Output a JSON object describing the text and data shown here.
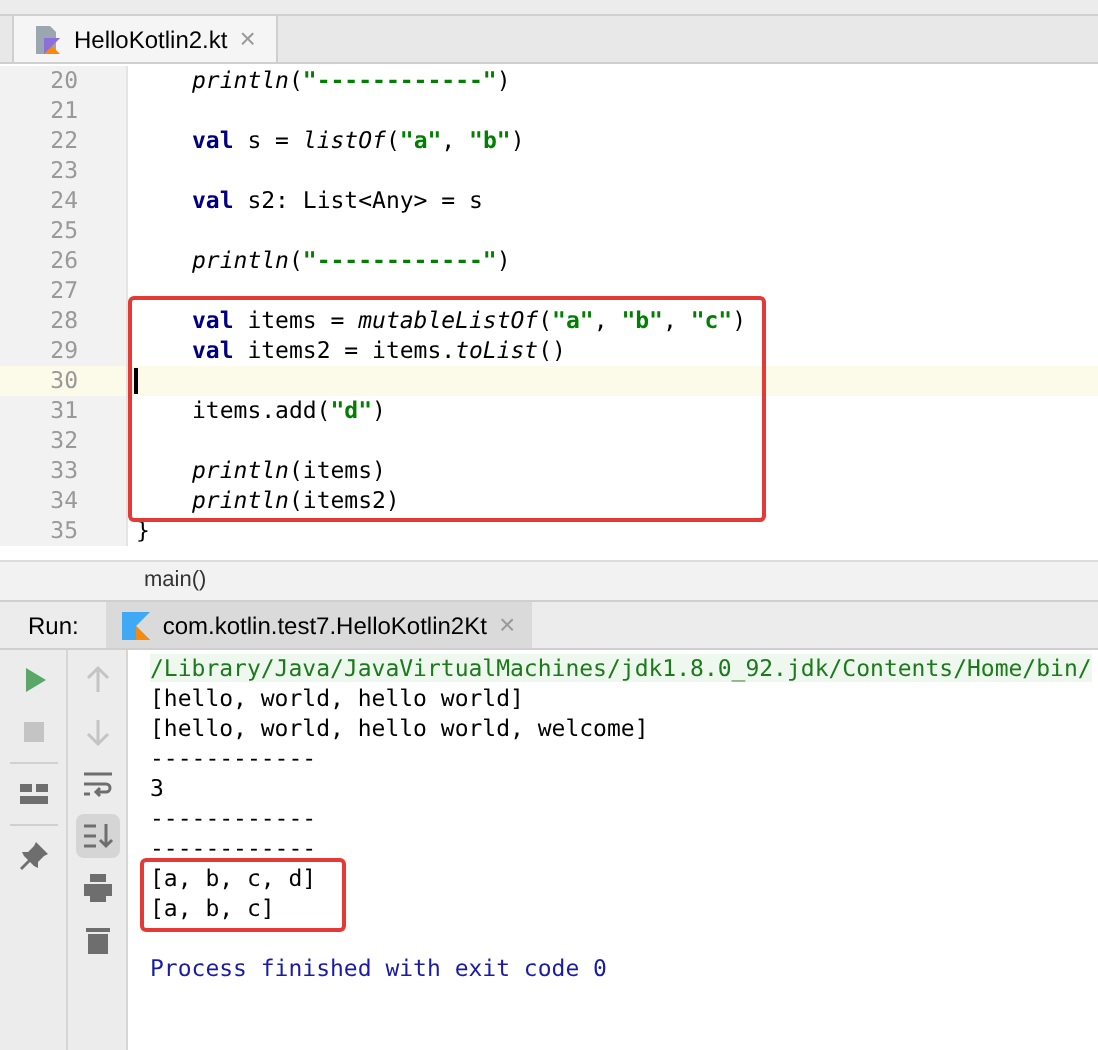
{
  "editor_tabs": [
    {
      "label": "HelloKotlin2.kt",
      "selected": true,
      "close": "×"
    }
  ],
  "code_lines": [
    {
      "number": "20",
      "current": false,
      "boxed": false,
      "indented": true,
      "tokens": [
        {
          "kind": "call",
          "text": "println"
        },
        {
          "kind": "plain",
          "text": "("
        },
        {
          "kind": "string",
          "text": "\"------------\""
        },
        {
          "kind": "plain",
          "text": ")"
        }
      ]
    },
    {
      "number": "21",
      "current": false,
      "boxed": false
    },
    {
      "number": "22",
      "current": false,
      "boxed": false,
      "indented": true,
      "tokens": [
        {
          "kind": "keyword",
          "text": "val"
        },
        {
          "kind": "plain",
          "text": " s = "
        },
        {
          "kind": "call",
          "text": "listOf"
        },
        {
          "kind": "plain",
          "text": "("
        },
        {
          "kind": "string",
          "text": "\"a\""
        },
        {
          "kind": "plain",
          "text": ", "
        },
        {
          "kind": "string",
          "text": "\"b\""
        },
        {
          "kind": "plain",
          "text": ")"
        }
      ]
    },
    {
      "number": "23",
      "current": false,
      "boxed": false
    },
    {
      "number": "24",
      "current": false,
      "boxed": false,
      "indented": true,
      "tokens": [
        {
          "kind": "keyword",
          "text": "val"
        },
        {
          "kind": "plain",
          "text": " s2: List<Any> = s"
        }
      ]
    },
    {
      "number": "25",
      "current": false,
      "boxed": false
    },
    {
      "number": "26",
      "current": false,
      "boxed": false,
      "indented": true,
      "tokens": [
        {
          "kind": "call",
          "text": "println"
        },
        {
          "kind": "plain",
          "text": "("
        },
        {
          "kind": "string",
          "text": "\"------------\""
        },
        {
          "kind": "plain",
          "text": ")"
        }
      ]
    },
    {
      "number": "27",
      "current": false,
      "boxed": false
    },
    {
      "number": "28",
      "current": false,
      "boxed": true,
      "indented": true,
      "tokens": [
        {
          "kind": "keyword",
          "text": "val"
        },
        {
          "kind": "plain",
          "text": " items = "
        },
        {
          "kind": "call",
          "text": "mutableListOf"
        },
        {
          "kind": "plain",
          "text": "("
        },
        {
          "kind": "string",
          "text": "\"a\""
        },
        {
          "kind": "plain",
          "text": ", "
        },
        {
          "kind": "string",
          "text": "\"b\""
        },
        {
          "kind": "plain",
          "text": ", "
        },
        {
          "kind": "string",
          "text": "\"c\""
        },
        {
          "kind": "plain",
          "text": ")"
        }
      ]
    },
    {
      "number": "29",
      "current": false,
      "boxed": true,
      "indented": true,
      "tokens": [
        {
          "kind": "keyword",
          "text": "val"
        },
        {
          "kind": "plain",
          "text": " items2 = items."
        },
        {
          "kind": "call",
          "text": "toList"
        },
        {
          "kind": "plain",
          "text": "()"
        }
      ]
    },
    {
      "number": "30",
      "current": true,
      "boxed": true
    },
    {
      "number": "31",
      "current": false,
      "boxed": true,
      "indented": true,
      "tokens": [
        {
          "kind": "plain",
          "text": "items.add("
        },
        {
          "kind": "string",
          "text": "\"d\""
        },
        {
          "kind": "plain",
          "text": ")"
        }
      ]
    },
    {
      "number": "32",
      "current": false,
      "boxed": true
    },
    {
      "number": "33",
      "current": false,
      "boxed": true,
      "indented": true,
      "tokens": [
        {
          "kind": "call",
          "text": "println"
        },
        {
          "kind": "plain",
          "text": "(items)"
        }
      ]
    },
    {
      "number": "34",
      "current": false,
      "boxed": true,
      "indented": true,
      "tokens": [
        {
          "kind": "call",
          "text": "println"
        },
        {
          "kind": "plain",
          "text": "(items2)"
        }
      ]
    },
    {
      "number": "35",
      "current": false,
      "boxed": false,
      "indented": false,
      "tokens": [
        {
          "kind": "plain",
          "text": "}"
        }
      ]
    }
  ],
  "structure_path": "main()",
  "run": {
    "label": "Run:",
    "tab": {
      "label": "com.kotlin.test7.HelloKotlin2Kt",
      "selected": true,
      "close": "×"
    },
    "left_tools": [
      {
        "disabled": false
      },
      {
        "disabled": true
      },
      {
        "disabled": false
      },
      {
        "disabled": false
      }
    ],
    "right_tools": [
      {
        "disabled": true,
        "selected": false
      },
      {
        "disabled": true,
        "selected": false
      },
      {
        "disabled": false,
        "selected": false
      },
      {
        "disabled": false,
        "selected": true
      },
      {
        "disabled": false,
        "selected": false
      },
      {
        "disabled": false,
        "selected": false
      }
    ],
    "console": [
      {
        "kind": "command",
        "boxed": false,
        "text": "/Library/Java/JavaVirtualMachines/jdk1.8.0_92.jdk/Contents/Home/bin/"
      },
      {
        "kind": "output",
        "boxed": false,
        "text": "[hello, world, hello world]"
      },
      {
        "kind": "output",
        "boxed": false,
        "text": "[hello, world, hello world, welcome]"
      },
      {
        "kind": "output",
        "boxed": false,
        "text": "------------"
      },
      {
        "kind": "output",
        "boxed": false,
        "text": "3"
      },
      {
        "kind": "output",
        "boxed": false,
        "text": "------------"
      },
      {
        "kind": "output",
        "boxed": false,
        "text": "------------"
      },
      {
        "kind": "output",
        "boxed": true,
        "text": "[a, b, c, d]"
      },
      {
        "kind": "output",
        "boxed": true,
        "text": "[a, b, c]"
      },
      {
        "kind": "blank",
        "boxed": false
      },
      {
        "kind": "system",
        "boxed": false,
        "text": "Process finished with exit code 0"
      }
    ]
  }
}
